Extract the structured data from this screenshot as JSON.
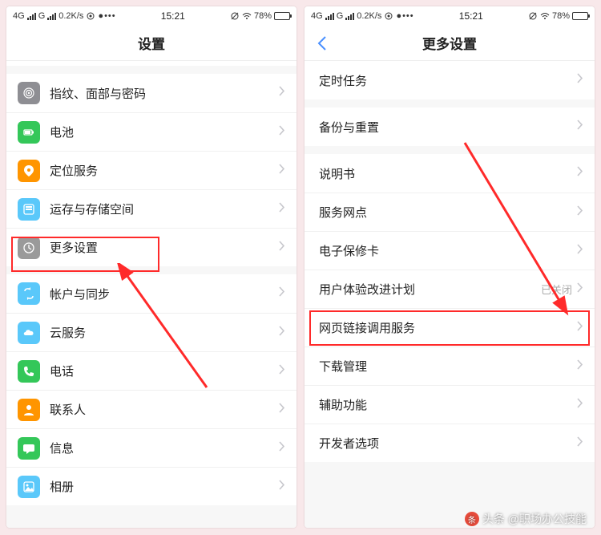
{
  "statusBar": {
    "network": "4G",
    "netext": "G",
    "speed": "0.2K/s",
    "time": "15:21",
    "batteryPct": "78%"
  },
  "screenLeft": {
    "title": "设置",
    "groups": [
      {
        "rows": [
          {
            "icon": "fingerprint-icon",
            "color": "#8e8e93",
            "label": "指纹、面部与密码"
          },
          {
            "icon": "battery-icon",
            "color": "#34c759",
            "label": "电池"
          },
          {
            "icon": "location-icon",
            "color": "#ff9500",
            "label": "定位服务"
          },
          {
            "icon": "storage-icon",
            "color": "#5ac8fa",
            "label": "运存与存储空间"
          },
          {
            "icon": "more-icon",
            "color": "#9a9a9a",
            "label": "更多设置"
          }
        ]
      },
      {
        "rows": [
          {
            "icon": "sync-icon",
            "color": "#5ac8fa",
            "label": "帐户与同步"
          },
          {
            "icon": "cloud-icon",
            "color": "#5ac8fa",
            "label": "云服务"
          },
          {
            "icon": "phone-icon",
            "color": "#34c759",
            "label": "电话"
          },
          {
            "icon": "contacts-icon",
            "color": "#ff9500",
            "label": "联系人"
          },
          {
            "icon": "message-icon",
            "color": "#34c759",
            "label": "信息"
          },
          {
            "icon": "gallery-icon",
            "color": "#5ac8fa",
            "label": "相册"
          }
        ]
      }
    ]
  },
  "screenRight": {
    "title": "更多设置",
    "groups": [
      {
        "rows": [
          {
            "label": "定时任务"
          }
        ]
      },
      {
        "rows": [
          {
            "label": "备份与重置"
          }
        ]
      },
      {
        "rows": [
          {
            "label": "说明书"
          },
          {
            "label": "服务网点"
          },
          {
            "label": "电子保修卡"
          },
          {
            "label": "用户体验改进计划",
            "value": "已关闭"
          },
          {
            "label": "网页链接调用服务"
          },
          {
            "label": "下载管理"
          },
          {
            "label": "辅助功能"
          },
          {
            "label": "开发者选项"
          }
        ]
      }
    ]
  },
  "watermark": {
    "badge": "条",
    "text": "头条 @职场办公技能"
  }
}
